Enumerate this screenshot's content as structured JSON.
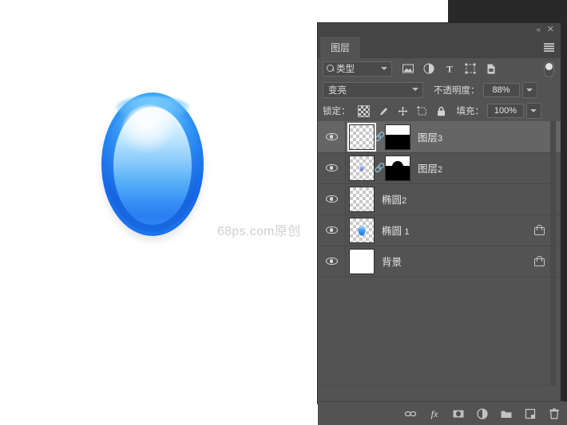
{
  "app": {
    "canvas": {
      "watermark": "68ps.com原创",
      "artwork_name": "blue-glossy-ellipse"
    }
  },
  "panel": {
    "titlebar": {
      "collapse_icon": "double-chevron-left-icon",
      "collapse_label": "«",
      "close_icon": "close-icon",
      "close_label": "✕"
    },
    "tab": {
      "label": "图层",
      "menu_icon": "hamburger-menu-icon"
    },
    "filter_row": {
      "search_icon": "search-icon",
      "search_value": "类型",
      "dropdown_icon": "chevron-down-icon",
      "icons": [
        {
          "name": "pixel-layer-filter-icon",
          "glyph": "image"
        },
        {
          "name": "adjustment-layer-filter-icon",
          "glyph": "half-circle"
        },
        {
          "name": "type-layer-filter-icon",
          "glyph": "T"
        },
        {
          "name": "shape-layer-filter-icon",
          "glyph": "shape"
        },
        {
          "name": "smart-object-filter-icon",
          "glyph": "document"
        }
      ],
      "toggle_name": "filter-enable-toggle"
    },
    "blend_row": {
      "blend_mode": "变亮",
      "opacity_label": "不透明度：",
      "opacity_value": "88%"
    },
    "lock_row": {
      "lock_label": "锁定：",
      "fill_label": "填充：",
      "fill_value": "100%",
      "icons": [
        {
          "name": "lock-transparent-pixels-icon"
        },
        {
          "name": "lock-image-pixels-icon"
        },
        {
          "name": "lock-position-icon"
        },
        {
          "name": "lock-artboard-nesting-icon"
        },
        {
          "name": "lock-all-icon"
        }
      ]
    },
    "layers": [
      {
        "name": "图层",
        "number": "3",
        "visible": true,
        "selected": true,
        "thumb_type": "empty",
        "linked": true,
        "has_mask": true,
        "mask_type": "half",
        "locked": false
      },
      {
        "name": "图层",
        "number": "2",
        "visible": true,
        "selected": false,
        "thumb_type": "dot",
        "linked": true,
        "has_mask": true,
        "mask_type": "dome",
        "locked": false
      },
      {
        "name": "椭圆",
        "number": "2",
        "visible": true,
        "selected": false,
        "thumb_type": "empty",
        "linked": false,
        "has_mask": false,
        "mask_type": "",
        "locked": false
      },
      {
        "name": "椭圆",
        "number": "1",
        "visible": true,
        "selected": false,
        "thumb_type": "egg",
        "linked": false,
        "has_mask": false,
        "mask_type": "",
        "locked": true
      },
      {
        "name": "背景",
        "number": "",
        "visible": true,
        "selected": false,
        "thumb_type": "white",
        "linked": false,
        "has_mask": false,
        "mask_type": "",
        "locked": true
      }
    ],
    "bottom_toolbar": [
      {
        "name": "link-layers-button",
        "glyph": "link"
      },
      {
        "name": "layer-style-fx-button",
        "glyph": "fx"
      },
      {
        "name": "add-layer-mask-button",
        "glyph": "mask"
      },
      {
        "name": "new-adjustment-layer-button",
        "glyph": "adjust"
      },
      {
        "name": "new-group-button",
        "glyph": "folder"
      },
      {
        "name": "new-layer-button",
        "glyph": "new"
      },
      {
        "name": "delete-layer-button",
        "glyph": "trash"
      }
    ]
  },
  "colors": {
    "panel_bg": "#535353",
    "panel_header": "#454545",
    "selected_row": "#656565",
    "backdrop": "#292929",
    "text": "#e4e4e4",
    "artwork_blue": "#1f7ff2"
  }
}
